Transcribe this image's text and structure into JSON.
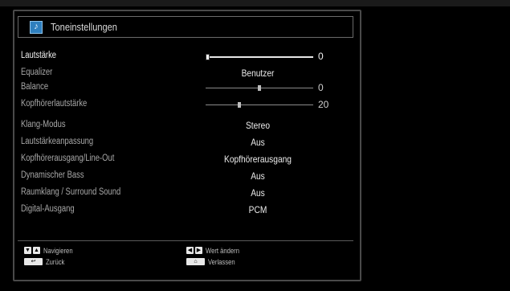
{
  "menu": {
    "title": "Toneinstellungen",
    "icon": "speaker-settings-icon"
  },
  "rows": [
    {
      "label": "Lautstärke",
      "type": "slider",
      "value": "0",
      "level": 0.0,
      "active": true
    },
    {
      "label": "Equalizer",
      "type": "select",
      "value": "Benutzer"
    },
    {
      "label": "Balance",
      "type": "slider",
      "value": "0",
      "level": 0.5
    },
    {
      "label": "Kopfhörerlautstärke",
      "type": "slider",
      "value": "20",
      "level": 0.31
    },
    {
      "label": "Klang-Modus",
      "type": "select",
      "value": "Stereo"
    },
    {
      "label": "Lautstärkeanpassung",
      "type": "select",
      "value": "Aus"
    },
    {
      "label": "Kopfhörerausgang/Line-Out",
      "type": "select",
      "value": "Kopfhörerausgang"
    },
    {
      "label": "Dynamischer Bass",
      "type": "select",
      "value": "Aus"
    },
    {
      "label": "Raumklang / Surround Sound",
      "type": "select",
      "value": "Aus"
    },
    {
      "label": "Digital-Ausgang",
      "type": "select",
      "value": "PCM"
    }
  ],
  "footer": {
    "navigate": "Navigieren",
    "back": "Zurück",
    "change_value": "Wert ändern",
    "exit": "Verlassen",
    "icons": [
      "down-arrow-key-icon",
      "up-arrow-key-icon",
      "back-key-icon",
      "left-arrow-key-icon",
      "right-arrow-key-icon",
      "home-key-icon"
    ]
  },
  "colors": {
    "active_text": "#f2f2f2",
    "inactive_text": "#a8a8a8",
    "icon_blue": "#2e7fbf"
  }
}
